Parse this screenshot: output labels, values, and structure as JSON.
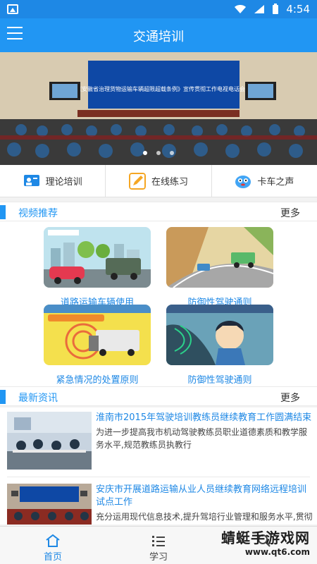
{
  "status_bar": {
    "time": "4:54"
  },
  "app_bar": {
    "title": "交通培训"
  },
  "banner": {
    "caption": "《安徽省治理货物运输车辆超限超载条例》宣传贯彻工作电视电话会议",
    "dots": 3,
    "active_dot": 0
  },
  "quick_actions": [
    {
      "label": "理论培训",
      "icon": "lecture-icon",
      "color": "#1e88e5"
    },
    {
      "label": "在线练习",
      "icon": "edit-icon",
      "color": "#f5a623"
    },
    {
      "label": "卡车之声",
      "icon": "mascot-icon",
      "color": "#42a5f5"
    }
  ],
  "videos_section": {
    "title": "视频推荐",
    "more": "更多",
    "items": [
      {
        "caption": "道路运输车辆使用",
        "thumb": "traffic-scene"
      },
      {
        "caption": "防御性驾驶通则",
        "thumb": "mountain-road"
      },
      {
        "caption": "紧急情况的处置原则",
        "thumb": "truck-braking"
      },
      {
        "caption": "防御性驾驶通则",
        "thumb": "driver-cab"
      }
    ]
  },
  "news_section": {
    "title": "最新资讯",
    "more": "更多",
    "items": [
      {
        "headline": "淮南市2015年驾驶培训教练员继续教育工作圆满结束",
        "desc": "为进一步提高我市机动驾驶教练员职业道德素质和教学服务水平,规范教练员执教行"
      },
      {
        "headline": "安庆市开展道路运输从业人员继续教育网络远程培训试点工作",
        "desc": "充分运用现代信息技术,提升驾培行业管理和服务水平,贯彻落实《道路运输从业人员继续"
      }
    ]
  },
  "bottom_nav": [
    {
      "label": "首页",
      "icon": "home-icon",
      "active": true
    },
    {
      "label": "学习",
      "icon": "list-icon",
      "active": false
    },
    {
      "label": "",
      "icon": "search-icon",
      "active": false
    }
  ],
  "watermark": {
    "big": "蜻蜓手游戏网",
    "small": "www.qt6.com"
  },
  "colors": {
    "primary": "#2196f3",
    "accent": "#1e88e5"
  }
}
